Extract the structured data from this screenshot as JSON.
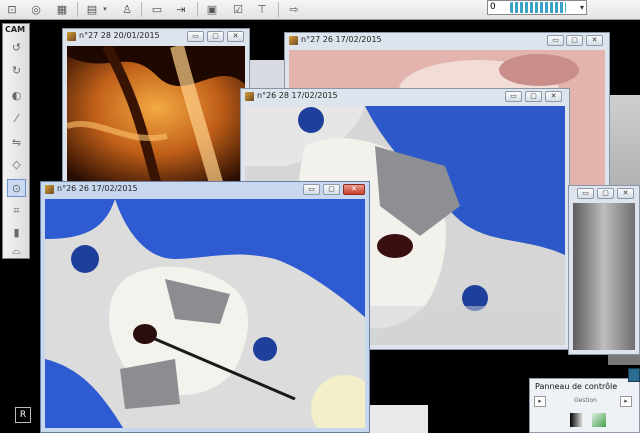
{
  "toolbar": {
    "icons": [
      "tooth-view-icon",
      "globe-icon",
      "grid-icon",
      "monitor-icon",
      "dropdown-arrow-icon",
      "person-icon",
      "scan-icon",
      "export-icon",
      "camera-icon",
      "checkbox-icon",
      "monitor-stand-icon",
      "exit-icon"
    ],
    "counter": {
      "value": "0"
    }
  },
  "palette": {
    "title": "CAM",
    "items": [
      "rotate-left-icon",
      "rotate-right-icon",
      "contrast-icon",
      "magic-wand-icon",
      "mirror-icon",
      "eraser-icon",
      "lens-icon",
      "crop-icon",
      "gradient-icon",
      "tooth-icon"
    ]
  },
  "windows": [
    {
      "id": "w1",
      "title": "n°27 28 20/01/2015"
    },
    {
      "id": "w2",
      "title": "n°27 26 17/02/2015"
    },
    {
      "id": "w3",
      "title": "n°26 28 17/02/2015"
    },
    {
      "id": "w4",
      "title": "n°26 26 17/02/2015"
    }
  ],
  "window_buttons": {
    "minimize": "▭",
    "restore": "▢",
    "close": "✕"
  },
  "bottom": {
    "r_button": "R"
  },
  "control_panel": {
    "title": "Panneau de contrôle",
    "label": "Gestion"
  },
  "colors": {
    "window_frame": "#dde4ee",
    "active_frame": "#c7d8ee",
    "close_red": "#c7412c"
  }
}
